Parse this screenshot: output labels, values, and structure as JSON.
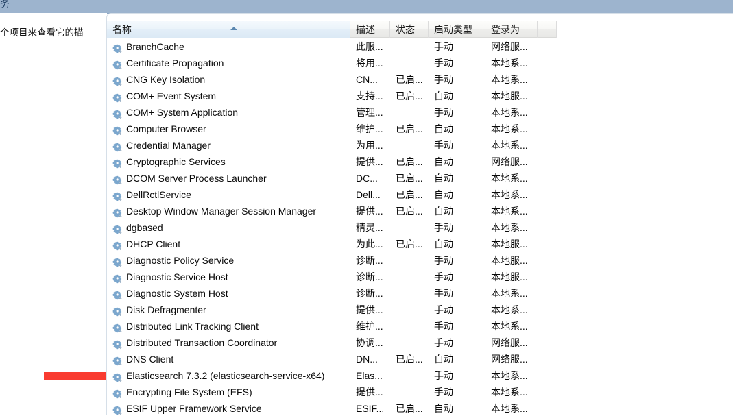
{
  "window": {
    "title_partial": "务"
  },
  "left_pane": {
    "description_partial": "个项目来查看它的描"
  },
  "annotation": {
    "marker_color": "#f93b30"
  },
  "list": {
    "sort_column": "名称",
    "sort_direction": "ascending",
    "columns": [
      {
        "key": "name",
        "label": "名称"
      },
      {
        "key": "desc",
        "label": "描述"
      },
      {
        "key": "state",
        "label": "状态"
      },
      {
        "key": "start",
        "label": "启动类型"
      },
      {
        "key": "logon",
        "label": "登录为"
      }
    ],
    "rows": [
      {
        "icon": "service-gear-icon",
        "name": "BranchCache",
        "desc": "此服...",
        "state": "",
        "start": "手动",
        "logon": "网络服..."
      },
      {
        "icon": "service-gear-icon",
        "name": "Certificate Propagation",
        "desc": "将用...",
        "state": "",
        "start": "手动",
        "logon": "本地系..."
      },
      {
        "icon": "service-gear-icon",
        "name": "CNG Key Isolation",
        "desc": "CN...",
        "state": "已启...",
        "start": "手动",
        "logon": "本地系..."
      },
      {
        "icon": "service-gear-icon",
        "name": "COM+ Event System",
        "desc": "支持...",
        "state": "已启...",
        "start": "自动",
        "logon": "本地服..."
      },
      {
        "icon": "service-gear-icon",
        "name": "COM+ System Application",
        "desc": "管理...",
        "state": "",
        "start": "手动",
        "logon": "本地系..."
      },
      {
        "icon": "service-gear-icon",
        "name": "Computer Browser",
        "desc": "维护...",
        "state": "已启...",
        "start": "自动",
        "logon": "本地系..."
      },
      {
        "icon": "service-gear-icon",
        "name": "Credential Manager",
        "desc": "为用...",
        "state": "",
        "start": "手动",
        "logon": "本地系..."
      },
      {
        "icon": "service-gear-icon",
        "name": "Cryptographic Services",
        "desc": "提供...",
        "state": "已启...",
        "start": "自动",
        "logon": "网络服..."
      },
      {
        "icon": "service-gear-icon",
        "name": "DCOM Server Process Launcher",
        "desc": "DC...",
        "state": "已启...",
        "start": "自动",
        "logon": "本地系..."
      },
      {
        "icon": "service-gear-icon",
        "name": "DellRctlService",
        "desc": "Dell...",
        "state": "已启...",
        "start": "自动",
        "logon": "本地系..."
      },
      {
        "icon": "service-gear-icon",
        "name": "Desktop Window Manager Session Manager",
        "desc": "提供...",
        "state": "已启...",
        "start": "自动",
        "logon": "本地系..."
      },
      {
        "icon": "service-gear-icon",
        "name": "dgbased",
        "desc": "精灵...",
        "state": "",
        "start": "手动",
        "logon": "本地系..."
      },
      {
        "icon": "service-gear-icon",
        "name": "DHCP Client",
        "desc": "为此...",
        "state": "已启...",
        "start": "自动",
        "logon": "本地服..."
      },
      {
        "icon": "service-gear-icon",
        "name": "Diagnostic Policy Service",
        "desc": "诊断...",
        "state": "",
        "start": "手动",
        "logon": "本地服..."
      },
      {
        "icon": "service-gear-icon",
        "name": "Diagnostic Service Host",
        "desc": "诊断...",
        "state": "",
        "start": "手动",
        "logon": "本地服..."
      },
      {
        "icon": "service-gear-icon",
        "name": "Diagnostic System Host",
        "desc": "诊断...",
        "state": "",
        "start": "手动",
        "logon": "本地系..."
      },
      {
        "icon": "service-gear-icon",
        "name": "Disk Defragmenter",
        "desc": "提供...",
        "state": "",
        "start": "手动",
        "logon": "本地系..."
      },
      {
        "icon": "service-gear-icon",
        "name": "Distributed Link Tracking Client",
        "desc": "维护...",
        "state": "",
        "start": "手动",
        "logon": "本地系..."
      },
      {
        "icon": "service-gear-icon",
        "name": "Distributed Transaction Coordinator",
        "desc": "协调...",
        "state": "",
        "start": "手动",
        "logon": "网络服..."
      },
      {
        "icon": "service-gear-icon",
        "name": "DNS Client",
        "desc": "DN...",
        "state": "已启...",
        "start": "自动",
        "logon": "网络服..."
      },
      {
        "icon": "service-gear-icon",
        "name": "Elasticsearch 7.3.2 (elasticsearch-service-x64)",
        "desc": "Elas...",
        "state": "",
        "start": "手动",
        "logon": "本地系..."
      },
      {
        "icon": "service-gear-icon",
        "name": "Encrypting File System (EFS)",
        "desc": "提供...",
        "state": "",
        "start": "手动",
        "logon": "本地系..."
      },
      {
        "icon": "service-gear-icon",
        "name": "ESIF Upper Framework Service",
        "desc": "ESIF...",
        "state": "已启...",
        "start": "自动",
        "logon": "本地系..."
      }
    ]
  }
}
